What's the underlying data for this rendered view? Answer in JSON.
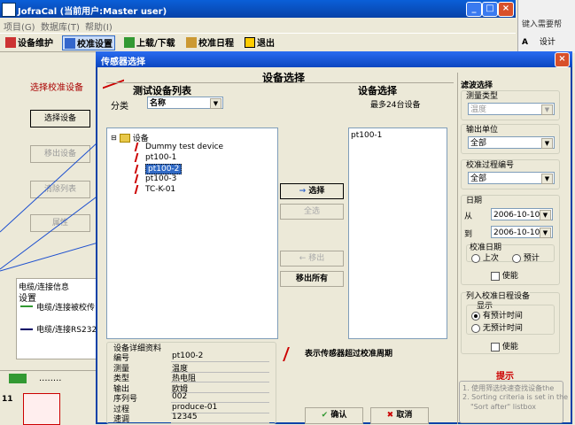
{
  "app": {
    "title": "JofraCal (当前用户:Master user)",
    "menu": [
      "项目(G)",
      "数据库(T)",
      "帮助(I)"
    ],
    "toolbar": [
      "设备维护",
      "校准设置",
      "上载/下载",
      "校准日程",
      "退出"
    ],
    "win_buttons": [
      "_",
      "□",
      "×"
    ]
  },
  "word_side": {
    "help_text": "键入需要帮",
    "design_label": "设计"
  },
  "left_panel": {
    "title": "选择校准设备",
    "buttons": [
      "选择设备",
      "移出设备",
      "清除列表",
      "属性"
    ]
  },
  "info_panel": {
    "title": "电缆/连接信息",
    "subtitle": "设置",
    "rows": [
      "电缆/连接被校传",
      "电缆/连接RS232"
    ]
  },
  "status_text": "........",
  "page_footer": "11",
  "dialog": {
    "title": "传感器选择",
    "header": "设备选择",
    "close": "×",
    "test_list": {
      "title": "测试设备列表",
      "category_label": "分类",
      "category_value": "名称",
      "root": "设备",
      "items": [
        "Dummy test device",
        "pt100-1",
        "pt100-2",
        "pt100-3",
        "TC-K-01"
      ],
      "selected": "pt100-2"
    },
    "device_select": {
      "title": "设备选择",
      "subtitle": "最多24台设备",
      "items": [
        "pt100-1"
      ]
    },
    "buttons": {
      "select": "选择",
      "select_all": "全选",
      "remove": "移出",
      "remove_all": "移出所有",
      "ok": "确认",
      "cancel": "取消"
    },
    "details": {
      "title": "设备详细资料",
      "rows": [
        {
          "k": "编号",
          "v": "pt100-2"
        },
        {
          "k": "测量",
          "v": "温度"
        },
        {
          "k": "类型",
          "v": "热电阻"
        },
        {
          "k": "输出",
          "v": "欧姆"
        },
        {
          "k": "序列号",
          "v": "002"
        },
        {
          "k": "过程",
          "v": "produce-01"
        },
        {
          "k": "速调",
          "v": "12345"
        }
      ]
    },
    "overdue_note": "表示传感器超过校准周期",
    "filter": {
      "title": "滤波选择",
      "measure_type_label": "测量类型",
      "measure_type_value": "温度",
      "output_unit_label": "输出单位",
      "output_unit_value": "全部",
      "procedure_label": "校准过程编号",
      "procedure_value": "全部",
      "date_label": "日期",
      "from_label": "从",
      "from_value": "2006-10-10",
      "to_label": "到",
      "to_value": "2006-10-10",
      "cal_date_label": "校准日期",
      "cal_date_opts": [
        "上次",
        "预计"
      ],
      "enable_label": "使能",
      "schedule_label": "列入校准日程设备",
      "show_label": "显示",
      "show_opts": [
        "有预计时间",
        "无预计时间"
      ],
      "enable_label2": "使能"
    },
    "tips": {
      "title": "提示",
      "lines": [
        "1. 使用筛选快速查找设备the",
        "2. Sorting criteria is set in the",
        "\"Sort after\" listbox"
      ]
    }
  }
}
